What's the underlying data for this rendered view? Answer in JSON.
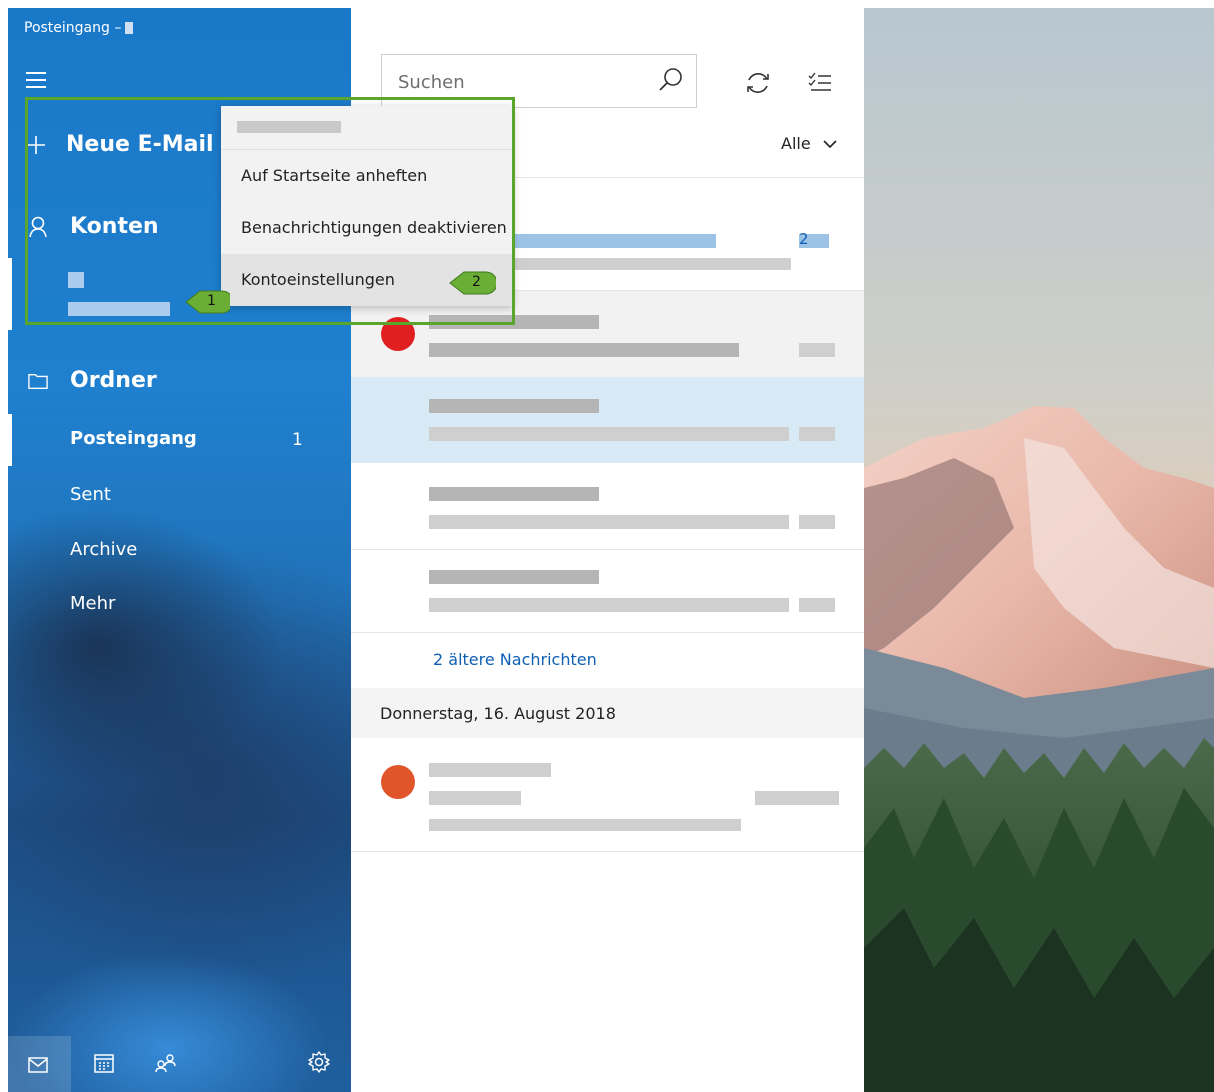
{
  "sidebar": {
    "app_title": "Posteingang –",
    "new_mail_label": "Neue E-Mail",
    "accounts_label": "Konten",
    "folders_label": "Ordner",
    "folders": [
      {
        "label": "Posteingang",
        "count": "1"
      },
      {
        "label": "Sent"
      },
      {
        "label": "Archive"
      },
      {
        "label": "Mehr"
      }
    ]
  },
  "context_menu": {
    "items": [
      "Auf Startseite anheften",
      "Benachrichtigungen deaktivieren",
      "Kontoeinstellungen"
    ]
  },
  "callouts": [
    "1",
    "2"
  ],
  "message_list": {
    "search_placeholder": "Suchen",
    "filter_label": "Alle",
    "unread_count": "2",
    "older_messages_link": "2 ältere Nachrichten",
    "date_header": "Donnerstag, 16. August 2018"
  },
  "colors": {
    "accent": "#1f80cf",
    "selection": "#d9eaf7",
    "link": "#0f5fb3",
    "callout_green": "#5aa62d"
  }
}
